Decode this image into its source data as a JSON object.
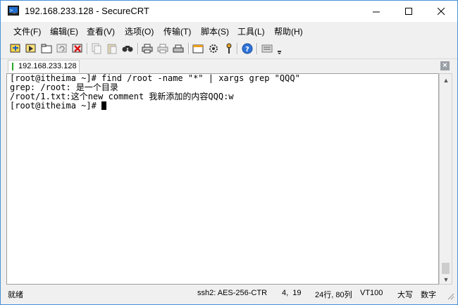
{
  "window": {
    "title": "192.168.233.128 - SecureCRT"
  },
  "menu": [
    "文件(F)",
    "编辑(E)",
    "查看(V)",
    "选项(O)",
    "传输(T)",
    "脚本(S)",
    "工具(L)",
    "帮助(H)"
  ],
  "toolbar": {
    "icons": [
      "connect-icon",
      "quick-connect-icon",
      "connect-in-tab-icon",
      "reconnect-icon",
      "disconnect-icon",
      "copy-icon",
      "paste-icon",
      "find-icon",
      "print-icon",
      "print-selection-icon",
      "print-setup-icon",
      "session-options-icon",
      "global-options-icon",
      "key-map-icon",
      "help-icon",
      "keyboard-icon",
      "more-icon"
    ]
  },
  "tabs": [
    {
      "label": "192.168.233.128",
      "active": true
    }
  ],
  "terminal": {
    "lines": [
      "[root@itheima ~]# find /root -name \"*\" | xargs grep \"QQQ\"",
      "grep: /root: 是一个目录",
      "/root/1.txt:这个new comment 我新添加的内容QQQ:w"
    ],
    "prompt": "[root@itheima ~]# "
  },
  "status": {
    "left": "就绪",
    "cipher": "ssh2: AES-256-CTR",
    "cursor_pos": "4,  19",
    "size": "24行, 80列",
    "terminal_type": "VT100",
    "caps": "大写",
    "num": "数字"
  },
  "colors": {
    "active_tab_marker": "#2aa52a",
    "window_border": "#4a90d9"
  }
}
